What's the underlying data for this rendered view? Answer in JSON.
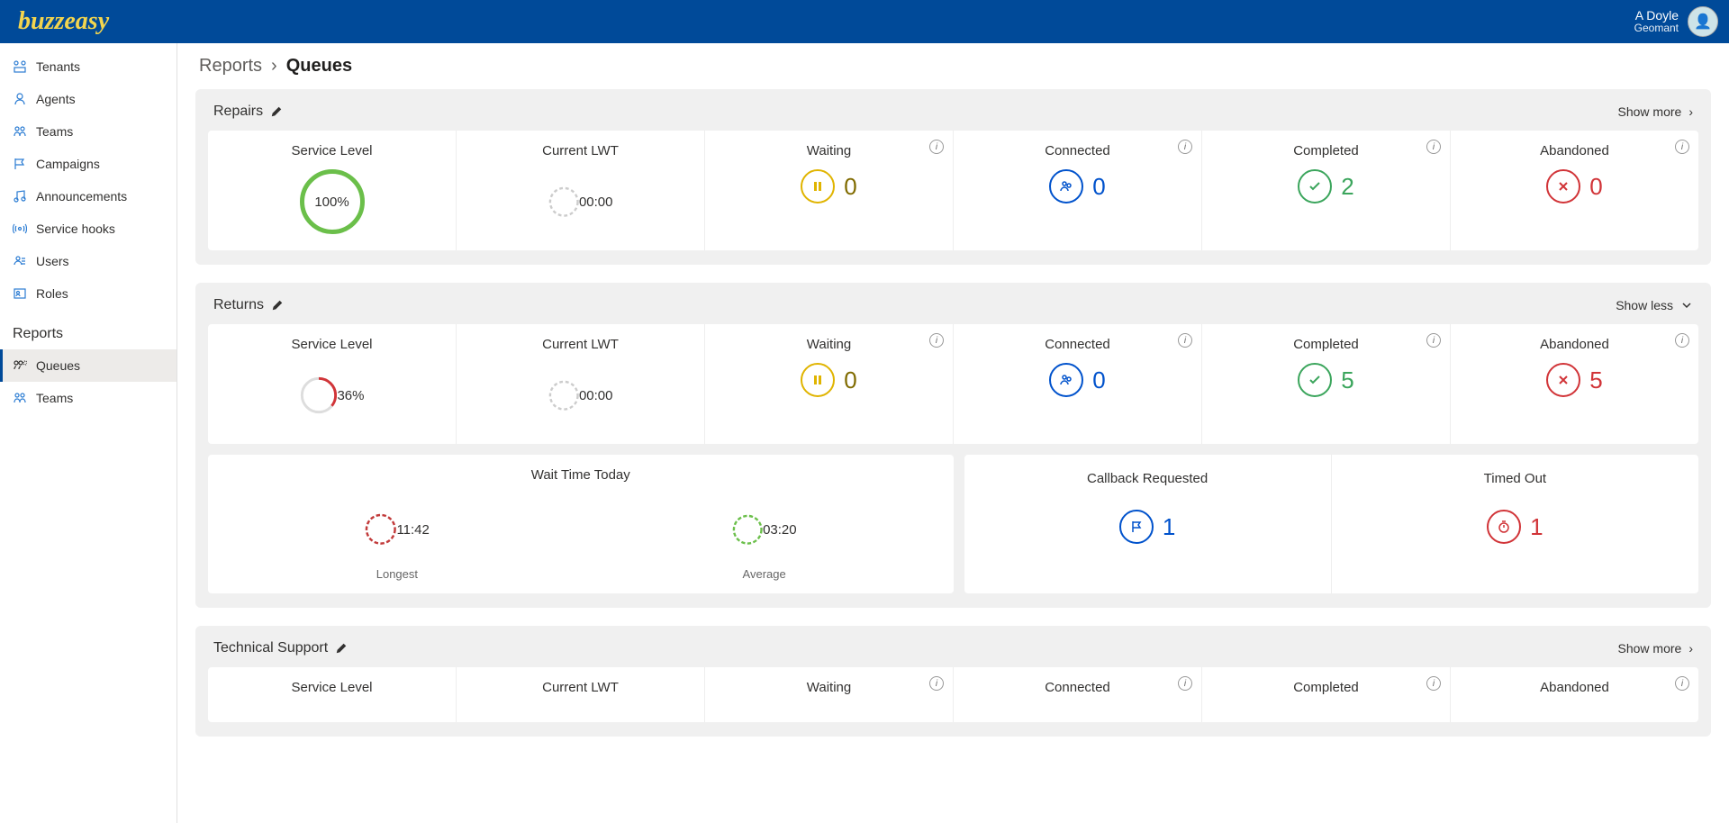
{
  "header": {
    "logo": "buzzeasy",
    "user_name": "A Doyle",
    "user_org": "Geomant"
  },
  "sidebar": {
    "items": [
      {
        "label": "Tenants"
      },
      {
        "label": "Agents"
      },
      {
        "label": "Teams"
      },
      {
        "label": "Campaigns"
      },
      {
        "label": "Announcements"
      },
      {
        "label": "Service hooks"
      },
      {
        "label": "Users"
      },
      {
        "label": "Roles"
      }
    ],
    "section_label": "Reports",
    "report_items": [
      {
        "label": "Queues"
      },
      {
        "label": "Teams"
      }
    ]
  },
  "breadcrumb": {
    "parent": "Reports",
    "current": "Queues"
  },
  "labels": {
    "service_level": "Service Level",
    "current_lwt": "Current LWT",
    "waiting": "Waiting",
    "connected": "Connected",
    "completed": "Completed",
    "abandoned": "Abandoned",
    "wait_time_today": "Wait Time Today",
    "longest": "Longest",
    "average": "Average",
    "callback_requested": "Callback Requested",
    "timed_out": "Timed Out",
    "show_more": "Show more",
    "show_less": "Show less"
  },
  "queues": [
    {
      "name": "Repairs",
      "expanded": false,
      "service_level_pct": "100%",
      "service_level_full": true,
      "current_lwt": "00:00",
      "waiting": "0",
      "connected": "0",
      "completed": "2",
      "abandoned": "0"
    },
    {
      "name": "Returns",
      "expanded": true,
      "service_level_pct": "36%",
      "service_level_full": false,
      "current_lwt": "00:00",
      "waiting": "0",
      "connected": "0",
      "completed": "5",
      "abandoned": "5",
      "wait_longest": "11:42",
      "wait_average": "03:20",
      "callback_requested": "1",
      "timed_out": "1"
    },
    {
      "name": "Technical Support",
      "expanded": false,
      "service_level_pct": "",
      "current_lwt": "",
      "waiting": "",
      "connected": "",
      "completed": "",
      "abandoned": ""
    }
  ]
}
